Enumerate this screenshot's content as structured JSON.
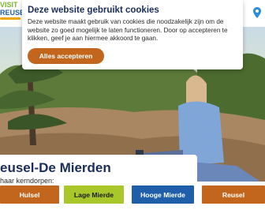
{
  "logo": {
    "line1": "VISIT",
    "line2": "REUSEL"
  },
  "cookie": {
    "title": "Deze website gebruikt cookies",
    "text": "Deze website maakt gebruik van cookies die noodzakelijk zijn om de website zo goed mogelijk te laten functioneren. Door op accepteren te klikken, geef je aan hiermee akkoord te gaan.",
    "accept_label": "Alles accepteren"
  },
  "hero": {
    "title": "eusel-De Mierden",
    "subtitle": "haar kerndorpen:"
  },
  "kerns": [
    {
      "label": "Hulsel",
      "color": "#c2661e"
    },
    {
      "label": "Lage Mierde",
      "color": "#a9c62a"
    },
    {
      "label": "Hooge Mierde",
      "color": "#1f5ea8"
    },
    {
      "label": "Reusel",
      "color": "#c2661e"
    }
  ],
  "icons": {
    "location": "map-pin-icon"
  }
}
